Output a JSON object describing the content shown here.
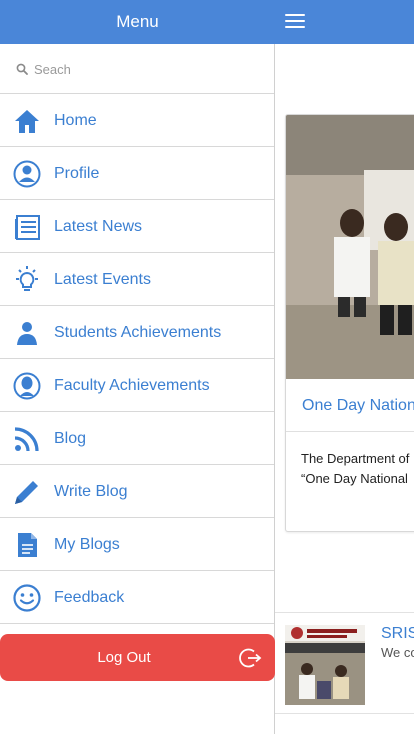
{
  "drawer": {
    "title": "Menu",
    "search": {
      "placeholder": "Seach",
      "icon": "search-icon"
    },
    "items": [
      {
        "label": "Home",
        "icon": "home-icon"
      },
      {
        "label": "Profile",
        "icon": "user-circle-icon"
      },
      {
        "label": "Latest News",
        "icon": "newspaper-icon"
      },
      {
        "label": "Latest Events",
        "icon": "lightbulb-icon"
      },
      {
        "label": "Students Achievements",
        "icon": "student-icon"
      },
      {
        "label": "Faculty Achievements",
        "icon": "faculty-icon"
      },
      {
        "label": "Blog",
        "icon": "rss-icon"
      },
      {
        "label": "Write Blog",
        "icon": "pencil-icon"
      },
      {
        "label": "My Blogs",
        "icon": "document-icon"
      },
      {
        "label": "Feedback",
        "icon": "smiley-icon"
      }
    ],
    "logout": {
      "label": "Log Out",
      "icon": "logout-icon"
    }
  },
  "main": {
    "menu_icon": "hamburger-icon",
    "card": {
      "title": "One Day Nation",
      "text_line1": "The Department of",
      "text_line2": "“One Day National"
    },
    "news": {
      "title": "SRIS",
      "subtitle": "We co"
    }
  },
  "colors": {
    "header": "#4a86d8",
    "accent_text": "#3b7fd1",
    "logout": "#e94b47"
  }
}
